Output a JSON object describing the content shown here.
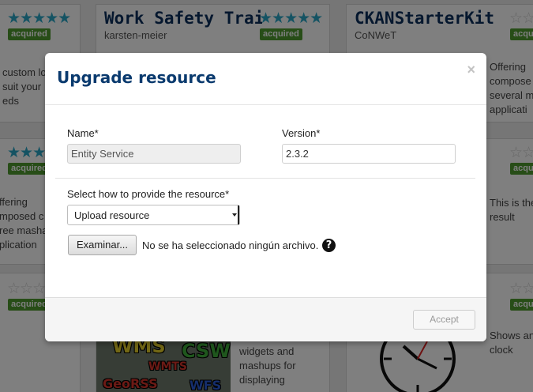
{
  "background": {
    "cards": [
      {
        "title": "",
        "owner": "",
        "description": [
          "custom lo",
          "suit your",
          "eds"
        ],
        "badge": "acquired",
        "rating": 5
      },
      {
        "title": "Work Safety Training",
        "owner": "karsten-meier",
        "badge": "acquired",
        "rating": 5
      },
      {
        "title": "CKANStarterKit",
        "owner": "CoNWeT",
        "badge": "acquired",
        "rating": 0
      },
      {
        "description": [
          "Offering",
          "compose",
          "several m",
          "applicati"
        ]
      },
      {
        "description": [
          "ffering",
          "mposed c",
          "ree masha",
          "plication"
        ],
        "badge": "acquired",
        "rating": 5
      },
      {
        "description": [
          "This is the",
          "result"
        ],
        "badge": "acquired",
        "rating": 0
      },
      {
        "badge": "acquired",
        "rating": 0
      },
      {
        "badge": "acquired",
        "rating": 0
      },
      {
        "description": [
          "widgets and",
          "mashups for",
          "displaying"
        ]
      },
      {
        "description": [
          "Shows an",
          "clock"
        ]
      }
    ],
    "maps_thumb": [
      "WMS",
      "CSW",
      "WMTS",
      "GeoRSS",
      "WFS"
    ]
  },
  "modal": {
    "title": "Upgrade resource",
    "close_glyph": "×",
    "name_label": "Name*",
    "name_value": "Entity Service",
    "version_label": "Version*",
    "version_value": "2.3.2",
    "method_label": "Select how to provide the resource*",
    "method_selected": "Upload resource",
    "file_button": "Examinar...",
    "file_status": "No se ha seleccionado ningún archivo.",
    "help_glyph": "?",
    "accept": "Accept"
  },
  "icons": {
    "help": "question-circle-icon",
    "close": "close-icon",
    "stars": "rating-stars-icon"
  },
  "colors": {
    "title": "#0a3a6e",
    "acquired_badge": "#4e9b2f",
    "star": "#2aa7c6"
  }
}
